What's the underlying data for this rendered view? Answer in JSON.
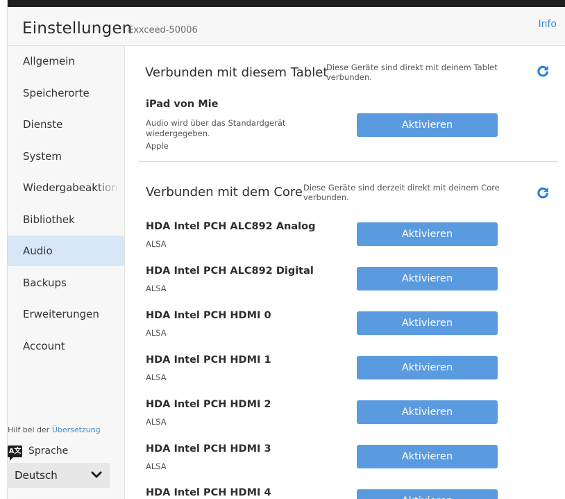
{
  "header": {
    "title": "Einstellungen",
    "subtitle": "Exxceed-50006",
    "info_label": "Info"
  },
  "sidebar": {
    "items": [
      {
        "label": "Allgemein",
        "active": false
      },
      {
        "label": "Speicherorte",
        "active": false
      },
      {
        "label": "Dienste",
        "active": false
      },
      {
        "label": "System",
        "active": false
      },
      {
        "label": "Wiedergabeaktionen",
        "active": false
      },
      {
        "label": "Bibliothek",
        "active": false
      },
      {
        "label": "Audio",
        "active": true
      },
      {
        "label": "Backups",
        "active": false
      },
      {
        "label": "Erweiterungen",
        "active": false
      },
      {
        "label": "Account",
        "active": false
      }
    ],
    "help_prefix": "Hilf bei der ",
    "help_link": "Übersetzung",
    "language_icon": "translate-icon",
    "language_icon_glyph": "A文",
    "language_label": "Sprache",
    "language_value": "Deutsch"
  },
  "tablet_section": {
    "title": "Verbunden mit diesem Tablet",
    "description": "Diese Geräte sind direkt mit deinem Tablet verbunden.",
    "device": {
      "name": "iPad von Mie",
      "detail": "Audio wird über das Standardgerät wiedergegeben.",
      "brand": "Apple",
      "button": "Aktivieren"
    }
  },
  "core_section": {
    "title": "Verbunden mit dem Core",
    "description": "Diese Geräte sind derzeit direkt mit deinem Core verbunden.",
    "devices": [
      {
        "name": "HDA Intel PCH ALC892 Analog",
        "type": "ALSA",
        "button": "Aktivieren"
      },
      {
        "name": "HDA Intel PCH ALC892 Digital",
        "type": "ALSA",
        "button": "Aktivieren"
      },
      {
        "name": "HDA Intel PCH HDMI 0",
        "type": "ALSA",
        "button": "Aktivieren"
      },
      {
        "name": "HDA Intel PCH HDMI 1",
        "type": "ALSA",
        "button": "Aktivieren"
      },
      {
        "name": "HDA Intel PCH HDMI 2",
        "type": "ALSA",
        "button": "Aktivieren"
      },
      {
        "name": "HDA Intel PCH HDMI 3",
        "type": "ALSA",
        "button": "Aktivieren"
      },
      {
        "name": "HDA Intel PCH HDMI 4",
        "type": "",
        "button": "Aktivieren"
      }
    ]
  },
  "colors": {
    "accent": "#3b8ad6",
    "button": "#5a9be0",
    "active_nav": "#d8e7f6",
    "sidebar_bg": "#f7f7f7"
  }
}
